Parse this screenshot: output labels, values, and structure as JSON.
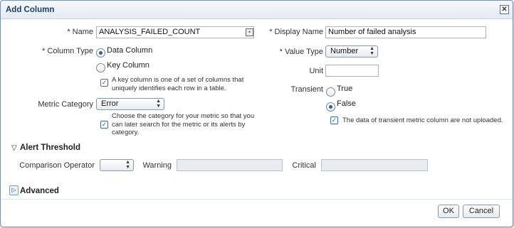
{
  "dialog": {
    "title": "Add Column",
    "close_glyph": "✕"
  },
  "form": {
    "name": {
      "label": "* Name",
      "value": "ANALYSIS_FAILED_COUNT"
    },
    "display_name": {
      "label": "* Display Name",
      "value": "Number of failed analysis"
    },
    "column_type": {
      "label": "* Column Type",
      "options": [
        "Data Column",
        "Key Column"
      ],
      "selected": "Data Column",
      "help": "A key column is one of a set of columns that uniquely identifies each row in a table."
    },
    "value_type": {
      "label": "* Value Type",
      "value": "Number"
    },
    "unit": {
      "label": "Unit",
      "value": ""
    },
    "transient": {
      "label": "Transient",
      "options": [
        "True",
        "False"
      ],
      "selected": "False",
      "help": "The data of transient metric column are not uploaded."
    },
    "metric_category": {
      "label": "Metric Category",
      "value": "Error",
      "help": "Choose the category for your metric so that you can later search for the metric or its alerts by category."
    }
  },
  "alert_threshold": {
    "header": "Alert Threshold",
    "comparison_operator": {
      "label": "Comparison Operator",
      "value": ""
    },
    "warning": {
      "label": "Warning",
      "value": ""
    },
    "critical": {
      "label": "Critical",
      "value": ""
    }
  },
  "advanced": {
    "header": "Advanced"
  },
  "buttons": {
    "ok": "OK",
    "cancel": "Cancel"
  },
  "icons": {
    "help": "help-check-icon",
    "expanded": "triangle-down-icon",
    "collapsed": "triangle-right-icon",
    "lookup": "lookup-icon"
  },
  "colors": {
    "title": "#1f3f66",
    "radio_selected": "#2b5f9e",
    "help_icon": "#2d5f98"
  }
}
